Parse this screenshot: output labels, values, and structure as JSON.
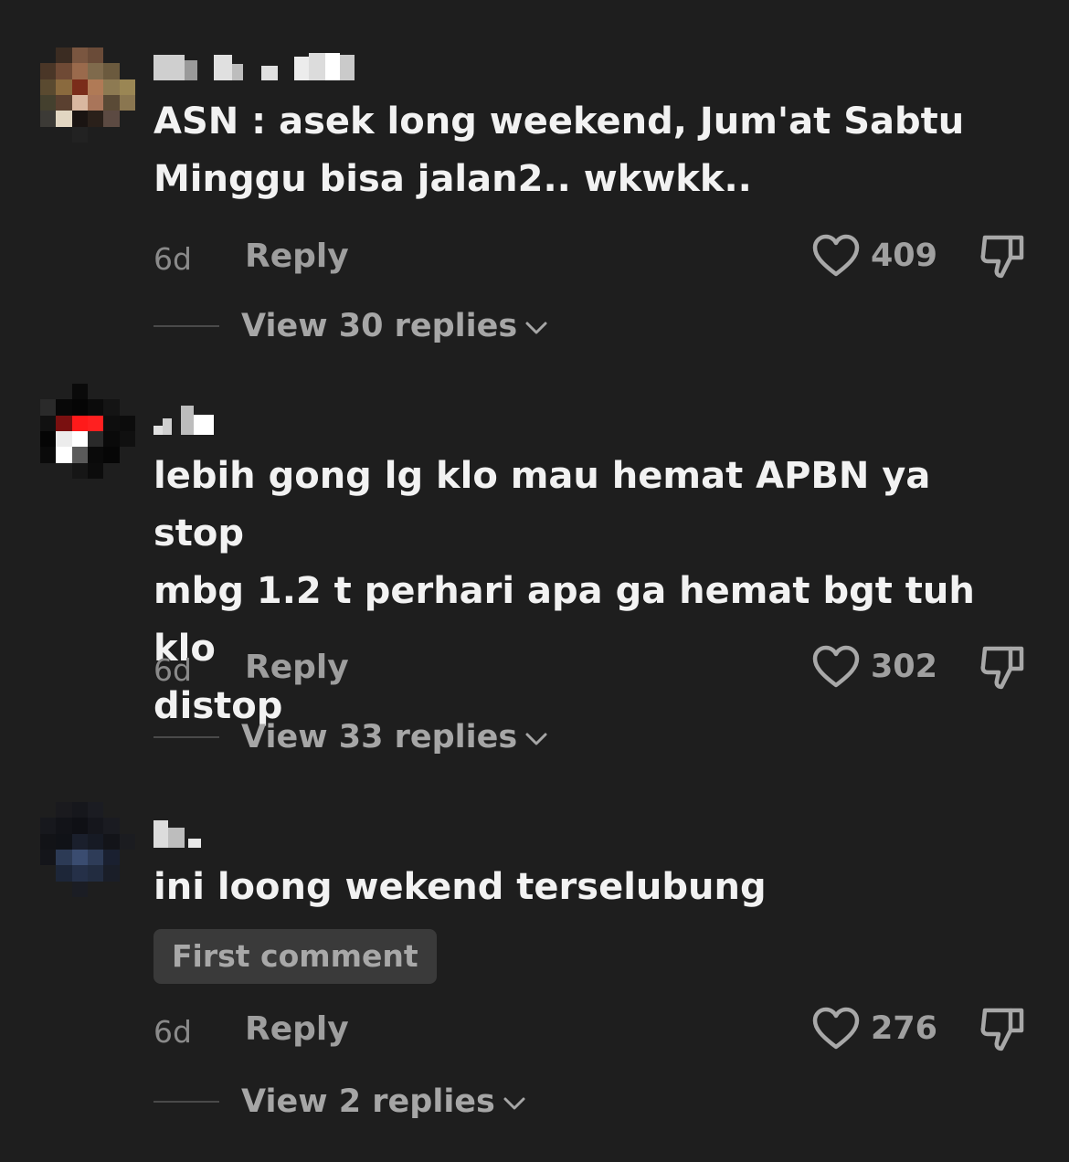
{
  "comments": [
    {
      "text_lines": [
        "ASN : asek long weekend, Jum'at Sabtu",
        "Minggu bisa jalan2.. wkwkk.."
      ],
      "time": "6d",
      "reply_label": "Reply",
      "likes": "409",
      "view_replies": "View 30 replies",
      "icons": [
        "heart-icon",
        "thumbs-down-icon",
        "chevron-down-icon"
      ]
    },
    {
      "text_lines": [
        "lebih gong lg klo mau hemat APBN ya stop",
        "mbg 1.2 t perhari apa ga hemat bgt tuh klo",
        "distop"
      ],
      "time": "6d",
      "reply_label": "Reply",
      "likes": "302",
      "view_replies": "View 33 replies",
      "icons": [
        "heart-icon",
        "thumbs-down-icon",
        "chevron-down-icon"
      ]
    },
    {
      "text_lines": [
        "ini loong wekend terselubung"
      ],
      "badge": "First comment",
      "time": "6d",
      "reply_label": "Reply",
      "likes": "276",
      "view_replies": "View 2 replies",
      "icons": [
        "heart-icon",
        "thumbs-down-icon",
        "chevron-down-icon"
      ]
    }
  ],
  "colors": {
    "background": "#1e1e1e",
    "text": "#f2f2f2",
    "muted": "#9e9e9e",
    "badge_bg": "#3a3a3a"
  }
}
